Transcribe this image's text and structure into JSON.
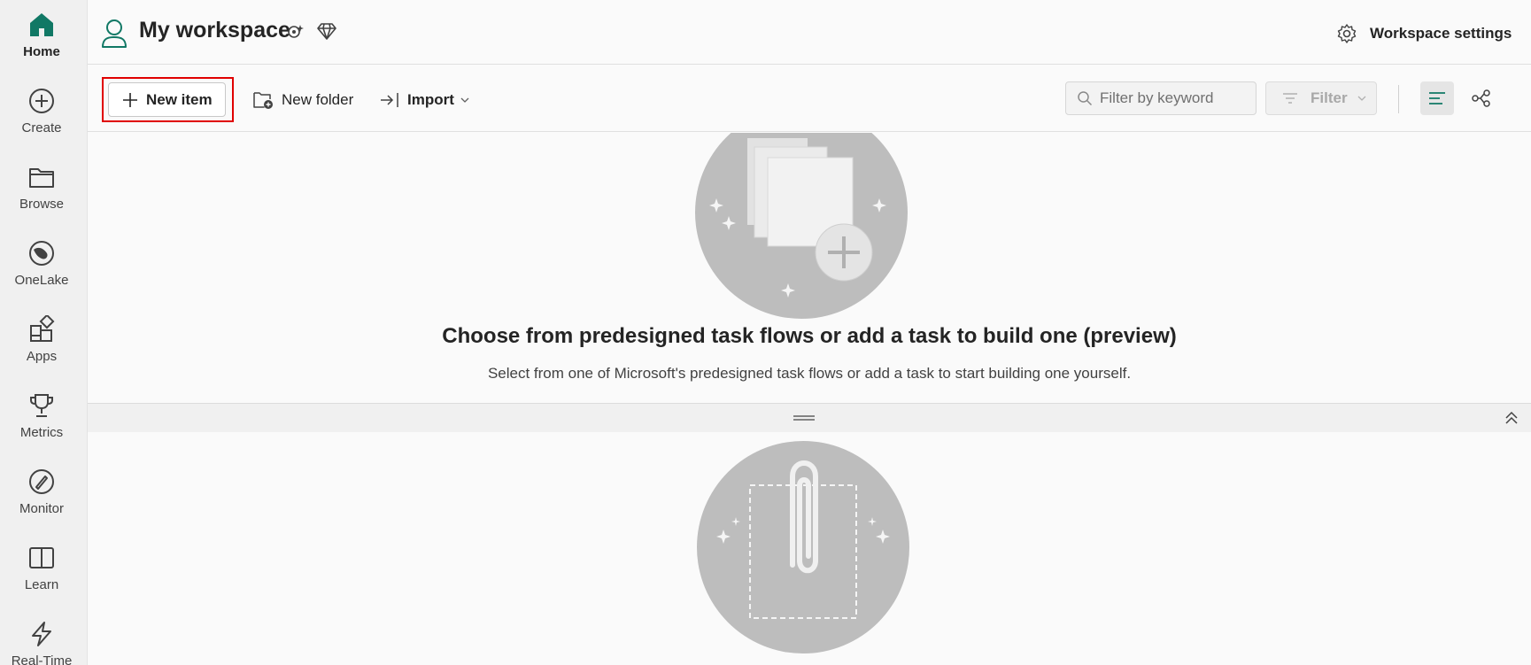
{
  "nav": {
    "items": [
      {
        "label": "Home",
        "icon": "home-icon",
        "active": true
      },
      {
        "label": "Create",
        "icon": "create-icon"
      },
      {
        "label": "Browse",
        "icon": "browse-icon"
      },
      {
        "label": "OneLake",
        "icon": "onelake-icon"
      },
      {
        "label": "Apps",
        "icon": "apps-icon"
      },
      {
        "label": "Metrics",
        "icon": "metrics-icon"
      },
      {
        "label": "Monitor",
        "icon": "monitor-icon"
      },
      {
        "label": "Learn",
        "icon": "learn-icon"
      },
      {
        "label": "Real-Time",
        "icon": "real-time-icon"
      }
    ]
  },
  "header": {
    "title": "My workspace",
    "settings_label": "Workspace settings"
  },
  "toolbar": {
    "new_item_label": "New item",
    "new_folder_label": "New folder",
    "import_label": "Import",
    "filter_placeholder": "Filter by keyword",
    "filter_label": "Filter"
  },
  "taskflow": {
    "title": "Choose from predesigned task flows or add a task to build one (preview)",
    "description": "Select from one of Microsoft's predesigned task flows or add a task to start building one yourself."
  },
  "colors": {
    "accent": "#117865",
    "highlight": "#e00000",
    "illustration": "#bdbdbd"
  }
}
